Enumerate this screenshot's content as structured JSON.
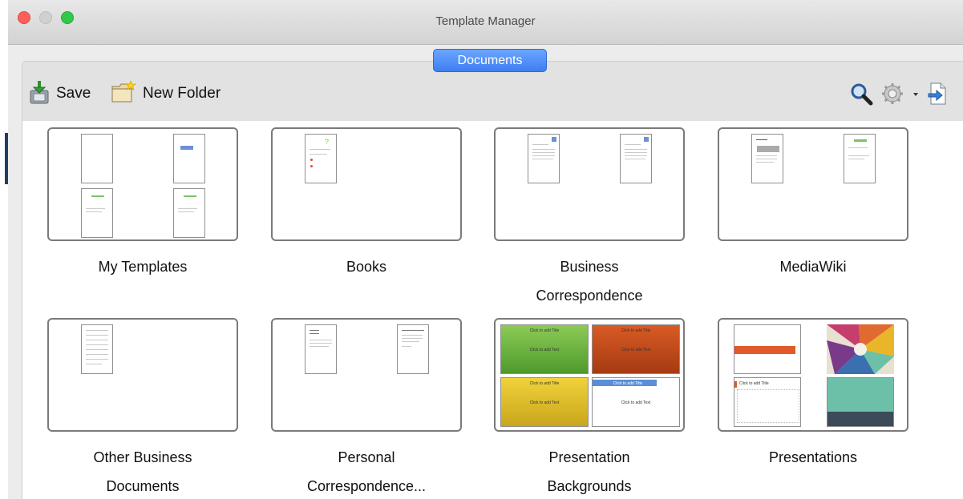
{
  "window": {
    "title": "Template Manager"
  },
  "tabs": {
    "active": "Documents"
  },
  "toolbar": {
    "save_label": "Save",
    "new_folder_label": "New Folder",
    "icons": [
      "save-icon",
      "new-folder-icon",
      "search-icon",
      "gear-icon",
      "chevron-down-icon",
      "import-icon"
    ]
  },
  "folders": [
    {
      "label": "My Templates"
    },
    {
      "label": "Books"
    },
    {
      "label": "Business\nCorrespondence"
    },
    {
      "label": "MediaWiki"
    },
    {
      "label": "Other Business\nDocuments"
    },
    {
      "label": "Personal\nCorrespondence..."
    },
    {
      "label": "Presentation\nBackgrounds"
    },
    {
      "label": "Presentations"
    }
  ],
  "slides": {
    "placeholder_title": "Click to add Title",
    "placeholder_text": "Click to add Text"
  },
  "colors": {
    "accent": "#3d7ef2",
    "green_bg": "#6db33f",
    "orange_bg": "#d35a24",
    "yellow_bg": "#e0c02a",
    "blue_band": "#5a8fd8",
    "orange_band": "#e05a2b",
    "teal": "#6cc0a8",
    "dark_slate": "#3c4a5a"
  }
}
